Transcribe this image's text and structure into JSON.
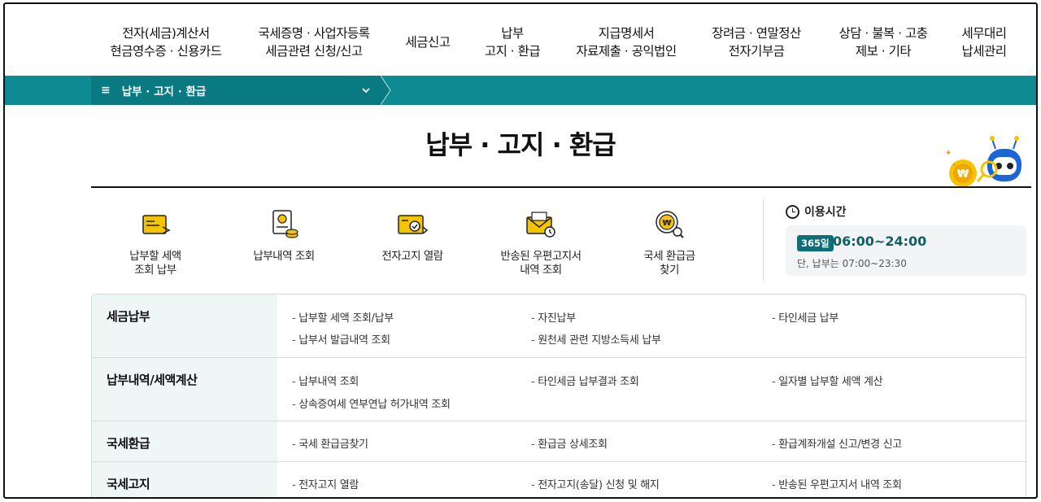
{
  "topnav": [
    {
      "line1": "전자(세금)계산서",
      "line2": "현금영수증 · 신용카드"
    },
    {
      "line1": "국세증명 · 사업자등록",
      "line2": "세금관련 신청/신고"
    },
    {
      "line1": "세금신고",
      "line2": ""
    },
    {
      "line1": "납부",
      "line2": "고지 · 환급"
    },
    {
      "line1": "지급명세서",
      "line2": "자료제출 · 공익법인"
    },
    {
      "line1": "장려금 · 연말정산",
      "line2": "전자기부금"
    },
    {
      "line1": "상담 · 불복 · 고충",
      "line2": "제보 · 기타"
    },
    {
      "line1": "세무대리",
      "line2": "납세관리"
    }
  ],
  "breadcrumb": {
    "menu_icon": "≡",
    "label": "납부 · 고지 · 환급",
    "chevron": "⌄"
  },
  "page_title": "납부 · 고지 · 환급",
  "quick_links": [
    {
      "icon": "tax-amount-icon",
      "line1": "납부할 세액",
      "line2": "조회 납부"
    },
    {
      "icon": "payment-history-icon",
      "line1": "납부내역 조회",
      "line2": ""
    },
    {
      "icon": "e-notice-icon",
      "line1": "전자고지 열람",
      "line2": ""
    },
    {
      "icon": "returned-mail-icon",
      "line1": "반송된 우편고지서",
      "line2": "내역 조회"
    },
    {
      "icon": "refund-search-icon",
      "line1": "국세 환급금",
      "line2": "찾기"
    }
  ],
  "hours": {
    "title": "이용시간",
    "badge": "365일",
    "time": "06:00~24:00",
    "note": "단, 납부는 07:00~23:30"
  },
  "menu": [
    {
      "category": "세금납부",
      "links": [
        "납부할 세액 조회/납부",
        "자진납부",
        "타인세금 납부",
        "납부서 발급내역 조회",
        "원천세 관련 지방소득세 납부"
      ]
    },
    {
      "category": "납부내역/세액계산",
      "links": [
        "납부내역 조회",
        "타인세금 납부결과 조회",
        "일자별 납부할 세액 계산",
        "상속증여세 연부연납 허가내역 조회"
      ]
    },
    {
      "category": "국세환급",
      "links": [
        "국세 환급금찾기",
        "환급금 상세조회",
        "환급계좌개설 신고/변경 신고"
      ]
    },
    {
      "category": "국세고지",
      "links": [
        "전자고지 열람",
        "전자고지(송달) 신청 및 해지",
        "반송된 우편고지서 내역 조회"
      ]
    }
  ],
  "colors": {
    "teal": "#0e8a92",
    "teal_dark": "#0a7a82",
    "accent_yellow": "#f5c400"
  }
}
